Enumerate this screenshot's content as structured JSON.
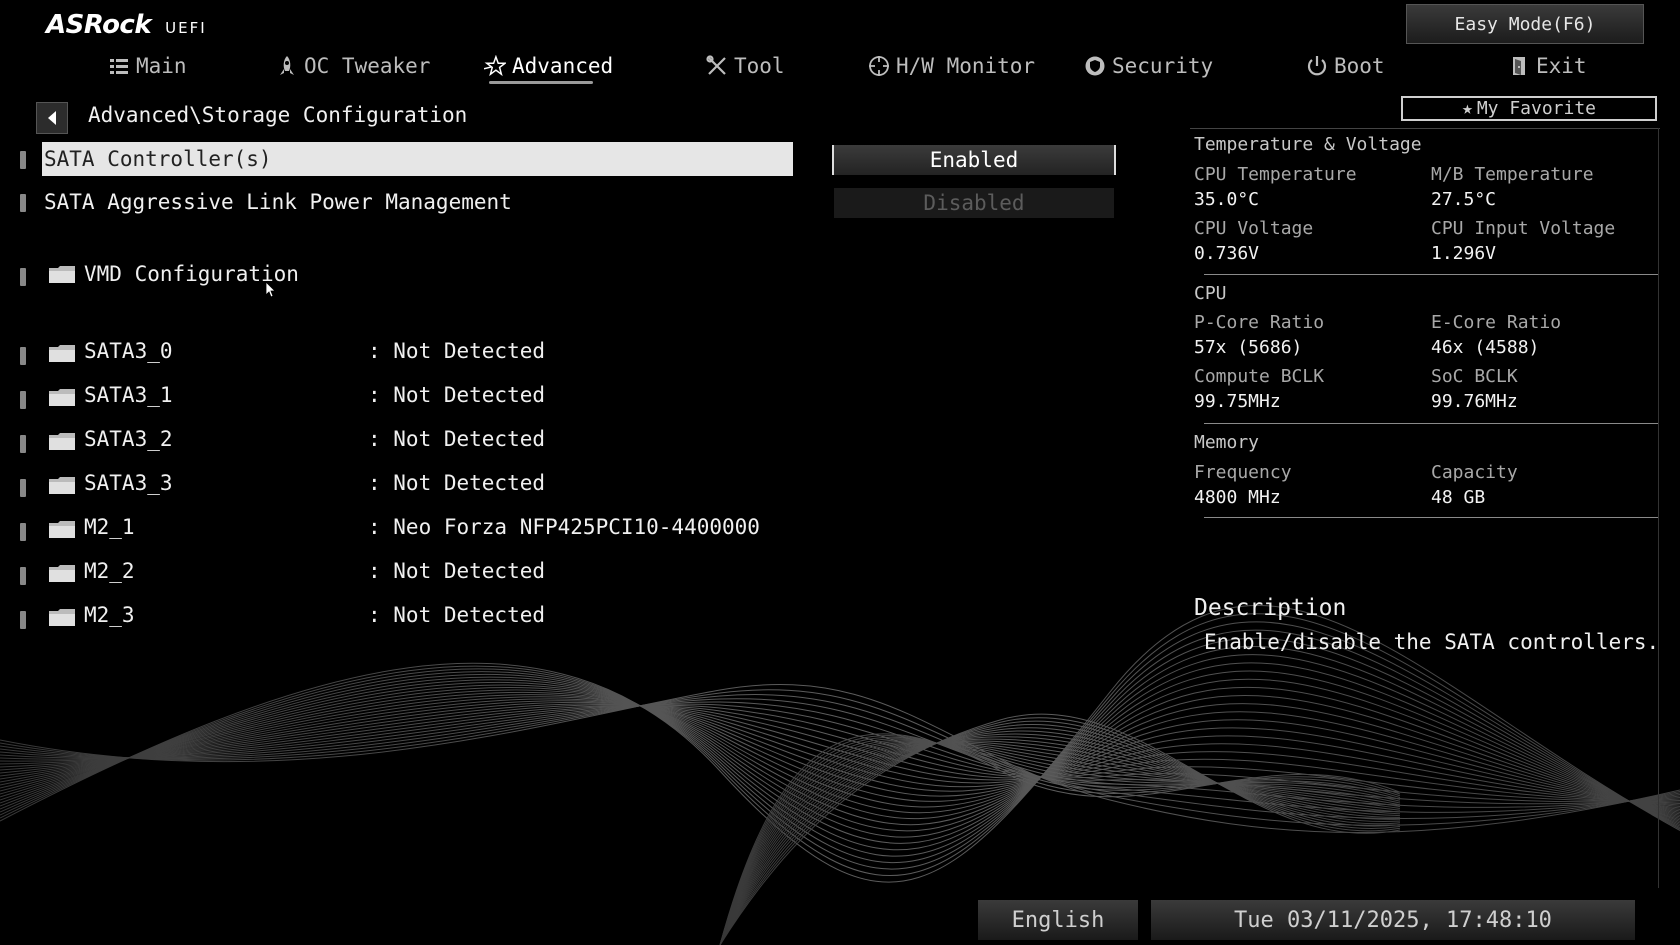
{
  "logo": {
    "brand": "ASRock",
    "suffix": "UEFI"
  },
  "easy_mode": "Easy Mode(F6)",
  "nav": [
    {
      "label": "Main",
      "icon": "list-icon"
    },
    {
      "label": "OC Tweaker",
      "icon": "rocket-icon"
    },
    {
      "label": "Advanced",
      "icon": "star-icon",
      "active": true
    },
    {
      "label": "Tool",
      "icon": "tools-icon"
    },
    {
      "label": "H/W Monitor",
      "icon": "monitor-icon"
    },
    {
      "label": "Security",
      "icon": "shield-icon"
    },
    {
      "label": "Boot",
      "icon": "power-icon"
    },
    {
      "label": "Exit",
      "icon": "exit-icon"
    }
  ],
  "breadcrumb": "Advanced\\Storage Configuration",
  "my_favorite": "My Favorite",
  "settings": [
    {
      "label": "SATA Controller(s)",
      "selected": true
    },
    {
      "label": "SATA Aggressive Link Power Management"
    }
  ],
  "options": {
    "enabled": "Enabled",
    "disabled": "Disabled"
  },
  "submenus": [
    {
      "label": "VMD Configuration"
    }
  ],
  "devices": [
    {
      "label": "SATA3_0",
      "value": ": Not Detected"
    },
    {
      "label": "SATA3_1",
      "value": ": Not Detected"
    },
    {
      "label": "SATA3_2",
      "value": ": Not Detected"
    },
    {
      "label": "SATA3_3",
      "value": ": Not Detected"
    },
    {
      "label": "M2_1",
      "value": ": Neo Forza NFP425PCI10-4400000"
    },
    {
      "label": "M2_2",
      "value": ": Not Detected"
    },
    {
      "label": "M2_3",
      "value": ": Not Detected"
    }
  ],
  "hw": {
    "temp_voltage_title": "Temperature & Voltage",
    "cpu_temp_label": "CPU Temperature",
    "cpu_temp": "35.0°C",
    "mb_temp_label": "M/B Temperature",
    "mb_temp": "27.5°C",
    "cpu_voltage_label": "CPU Voltage",
    "cpu_voltage": "0.736V",
    "cpu_input_voltage_label": "CPU Input Voltage",
    "cpu_input_voltage": "1.296V",
    "cpu_title": "CPU",
    "pcore_label": "P-Core Ratio",
    "pcore": "57x (5686)",
    "ecore_label": "E-Core Ratio",
    "ecore": "46x (4588)",
    "compute_bclk_label": "Compute BCLK",
    "compute_bclk": "99.75MHz",
    "soc_bclk_label": "SoC BCLK",
    "soc_bclk": "99.76MHz",
    "memory_title": "Memory",
    "frequency_label": "Frequency",
    "frequency": "4800 MHz",
    "capacity_label": "Capacity",
    "capacity": "48 GB"
  },
  "description": {
    "title": "Description",
    "text": "Enable/disable the SATA controllers."
  },
  "footer": {
    "language": "English",
    "datetime": "Tue 03/11/2025, 17:48:10"
  }
}
